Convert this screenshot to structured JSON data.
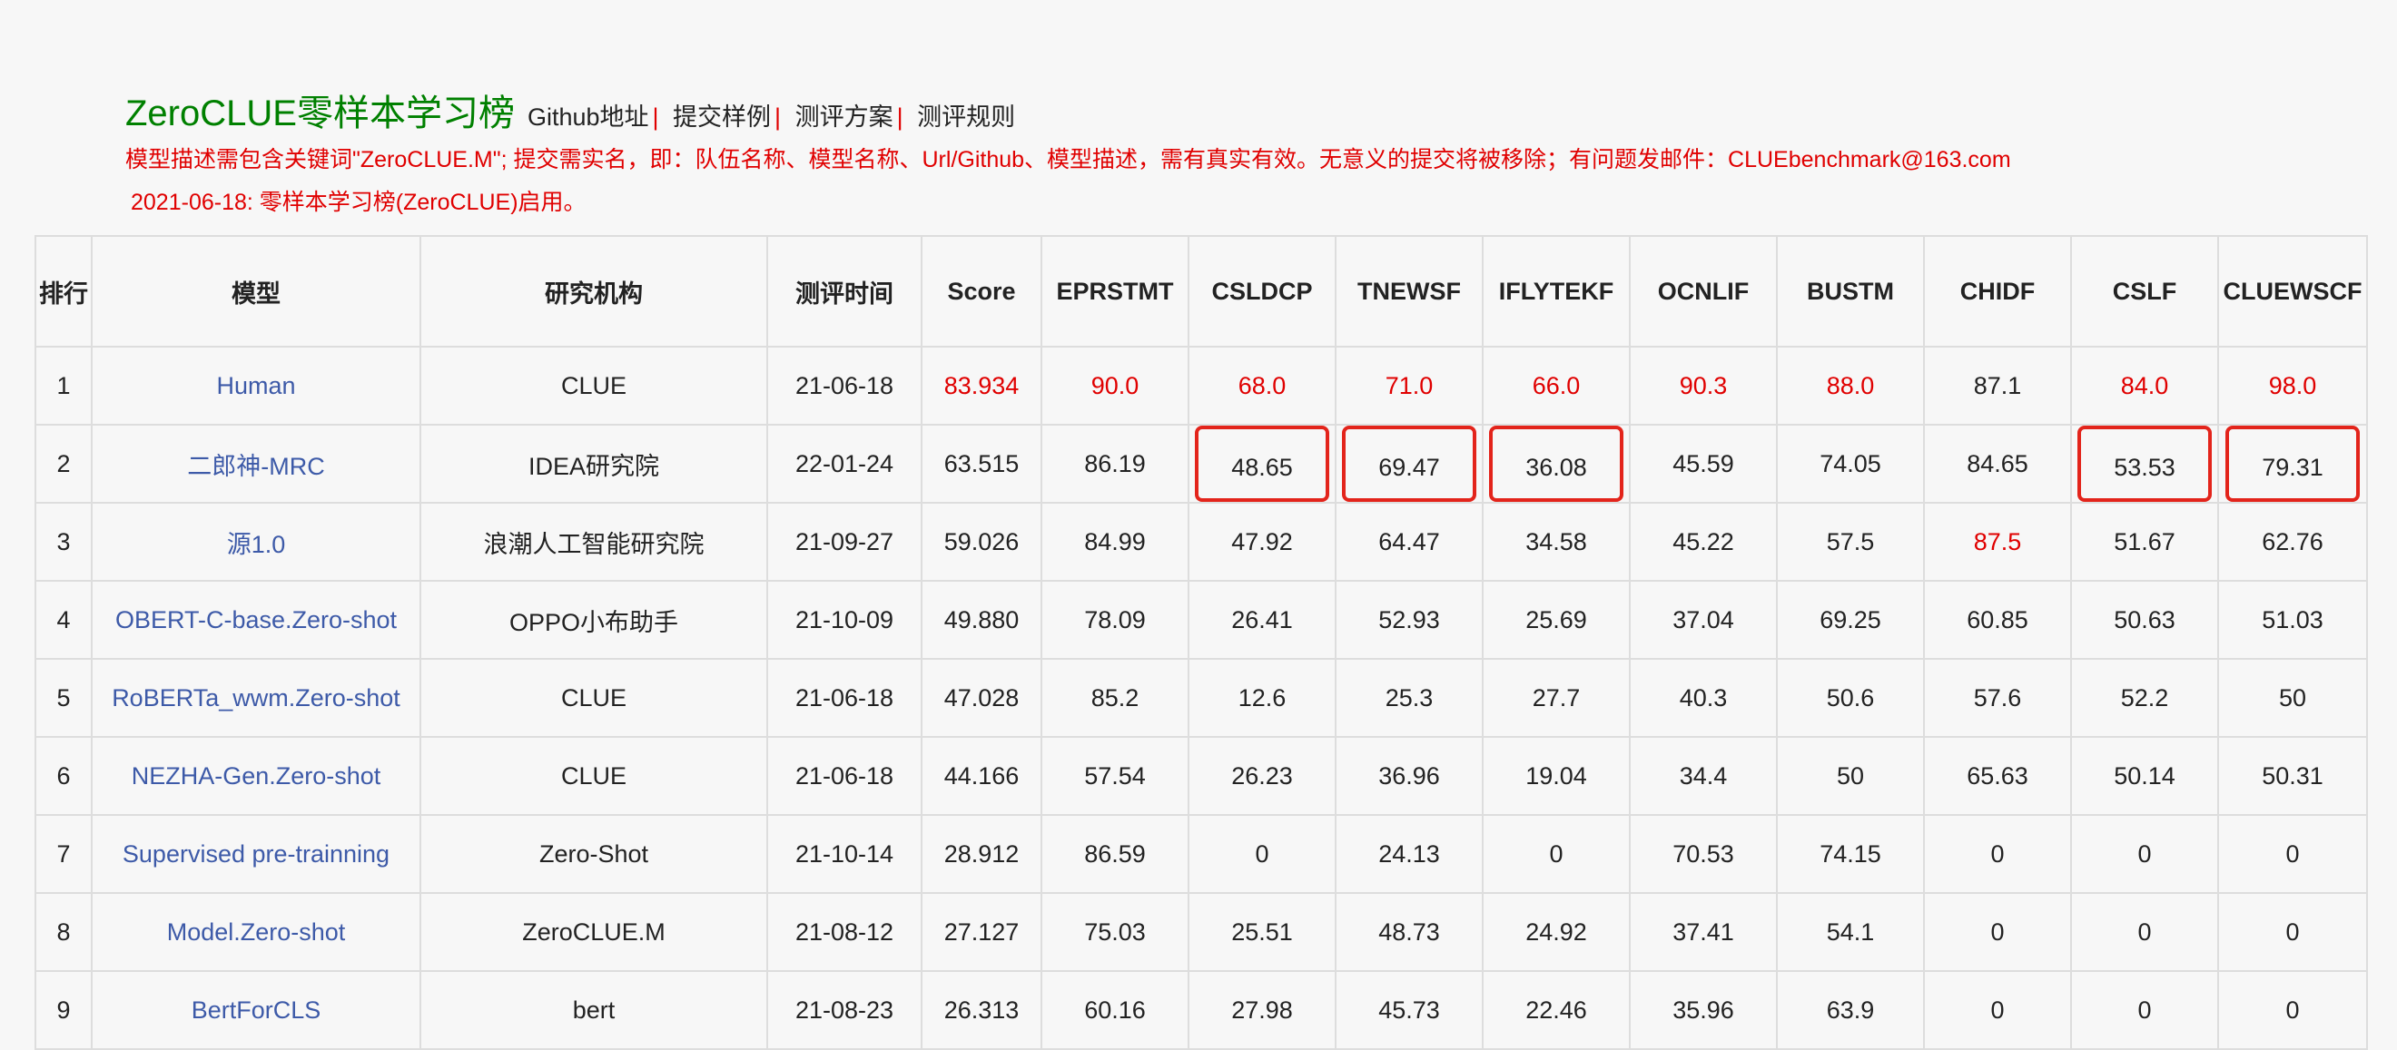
{
  "header": {
    "title": "ZeroCLUE零样本学习榜",
    "links": [
      "Github地址",
      "提交样例",
      "测评方案",
      "测评规则"
    ],
    "separator": "|",
    "notice": "模型描述需包含关键词\"ZeroCLUE.M\"; 提交需实名，即：队伍名称、模型名称、Url/Github、模型描述，需有真实有效。无意义的提交将被移除；有问题发邮件：CLUEbenchmark@163.com",
    "news": "2021-06-18: 零样本学习榜(ZeroCLUE)启用。"
  },
  "table": {
    "headers": [
      "排行",
      "模型",
      "研究机构",
      "测评时间",
      "Score",
      "EPRSTMT",
      "CSLDCP",
      "TNEWSF",
      "IFLYTEKF",
      "OCNLIF",
      "BUSTM",
      "CHIDF",
      "CSLF",
      "CLUEWSCF"
    ],
    "rows": [
      [
        "1",
        "Human",
        "CLUE",
        "21-06-18",
        "83.934",
        "90.0",
        "68.0",
        "71.0",
        "66.0",
        "90.3",
        "88.0",
        "87.1",
        "84.0",
        "98.0"
      ],
      [
        "2",
        "二郎神-MRC",
        "IDEA研究院",
        "22-01-24",
        "63.515",
        "86.19",
        "48.65",
        "69.47",
        "36.08",
        "45.59",
        "74.05",
        "84.65",
        "53.53",
        "79.31"
      ],
      [
        "3",
        "源1.0",
        "浪潮人工智能研究院",
        "21-09-27",
        "59.026",
        "84.99",
        "47.92",
        "64.47",
        "34.58",
        "45.22",
        "57.5",
        "87.5",
        "51.67",
        "62.76"
      ],
      [
        "4",
        "OBERT-C-base.Zero-shot",
        "OPPO小布助手",
        "21-10-09",
        "49.880",
        "78.09",
        "26.41",
        "52.93",
        "25.69",
        "37.04",
        "69.25",
        "60.85",
        "50.63",
        "51.03"
      ],
      [
        "5",
        "RoBERTa_wwm.Zero-shot",
        "CLUE",
        "21-06-18",
        "47.028",
        "85.2",
        "12.6",
        "25.3",
        "27.7",
        "40.3",
        "50.6",
        "57.6",
        "52.2",
        "50"
      ],
      [
        "6",
        "NEZHA-Gen.Zero-shot",
        "CLUE",
        "21-06-18",
        "44.166",
        "57.54",
        "26.23",
        "36.96",
        "19.04",
        "34.4",
        "50",
        "65.63",
        "50.14",
        "50.31"
      ],
      [
        "7",
        "Supervised pre-trainning",
        "Zero-Shot",
        "21-10-14",
        "28.912",
        "86.59",
        "0",
        "24.13",
        "0",
        "70.53",
        "74.15",
        "0",
        "0",
        "0"
      ],
      [
        "8",
        "Model.Zero-shot",
        "ZeroCLUE.M",
        "21-08-12",
        "27.127",
        "75.03",
        "25.51",
        "48.73",
        "24.92",
        "37.41",
        "54.1",
        "0",
        "0",
        "0"
      ],
      [
        "9",
        "BertForCLS",
        "bert",
        "21-08-23",
        "26.313",
        "60.16",
        "27.98",
        "45.73",
        "22.46",
        "35.96",
        "63.9",
        "0",
        "0",
        "0"
      ]
    ]
  },
  "highlights": {
    "red_cells": [
      "0.4",
      "0.5",
      "0.6",
      "0.7",
      "0.8",
      "0.9",
      "0.10",
      "0.12",
      "0.13",
      "2.11"
    ],
    "boxed_cells": [
      "1.6",
      "1.7",
      "1.8",
      "1.12",
      "1.13"
    ]
  },
  "colors": {
    "title": "#008000",
    "notice": "#e00000",
    "model_link": "#3d5aa8",
    "highlight_box": "#e3241b",
    "border": "#dddddd"
  }
}
